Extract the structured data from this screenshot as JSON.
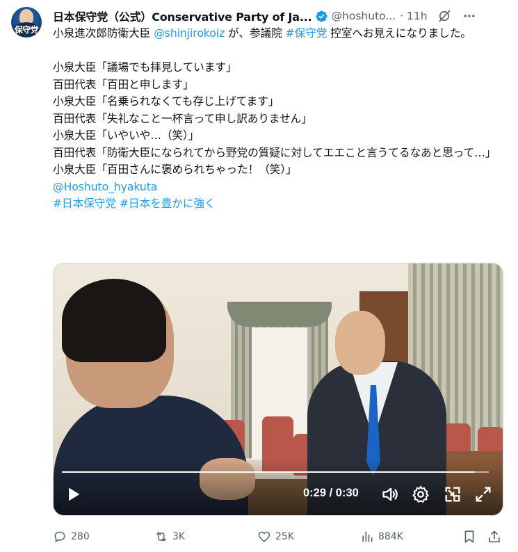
{
  "tweet": {
    "avatar_text": "保守党",
    "display_name": "日本保守党（公式）Conservative Party of Ja...",
    "handle": "@hoshuto...",
    "time": "· 11h",
    "text": {
      "l1a": "小泉進次郎防衛大臣 ",
      "mention1": "@shinjirokoiz",
      "l1b": " が、参議院 ",
      "hashtag1": "#保守党",
      "l1c": " 控室へお見えになりました。",
      "dialogue": "\n\n小泉大臣「議場でも拝見しています」\n百田代表「百田と申します」\n小泉大臣「名乗られなくても存じ上げてます」\n百田代表「失礼なこと一杯言って申し訳ありません」\n小泉大臣「いやいや…（笑）」\n百田代表「防衛大臣になられてから野党の質疑に対してエエこと言うてるなあと思って…」\n小泉大臣「百田さんに褒められちゃった！（笑）」\n",
      "mention2": "@Hoshuto_hyakuta",
      "hashtag2": "#日本保守党",
      "hashtag3": "#日本を豊かに強く"
    }
  },
  "video": {
    "time": "0:29 / 0:30",
    "progress": 0.967
  },
  "actions": {
    "replies": "280",
    "reposts": "3K",
    "likes": "25K",
    "views": "884K"
  },
  "colors": {
    "accent": "#1d9bf0",
    "muted": "#536471",
    "text": "#0f1419"
  }
}
